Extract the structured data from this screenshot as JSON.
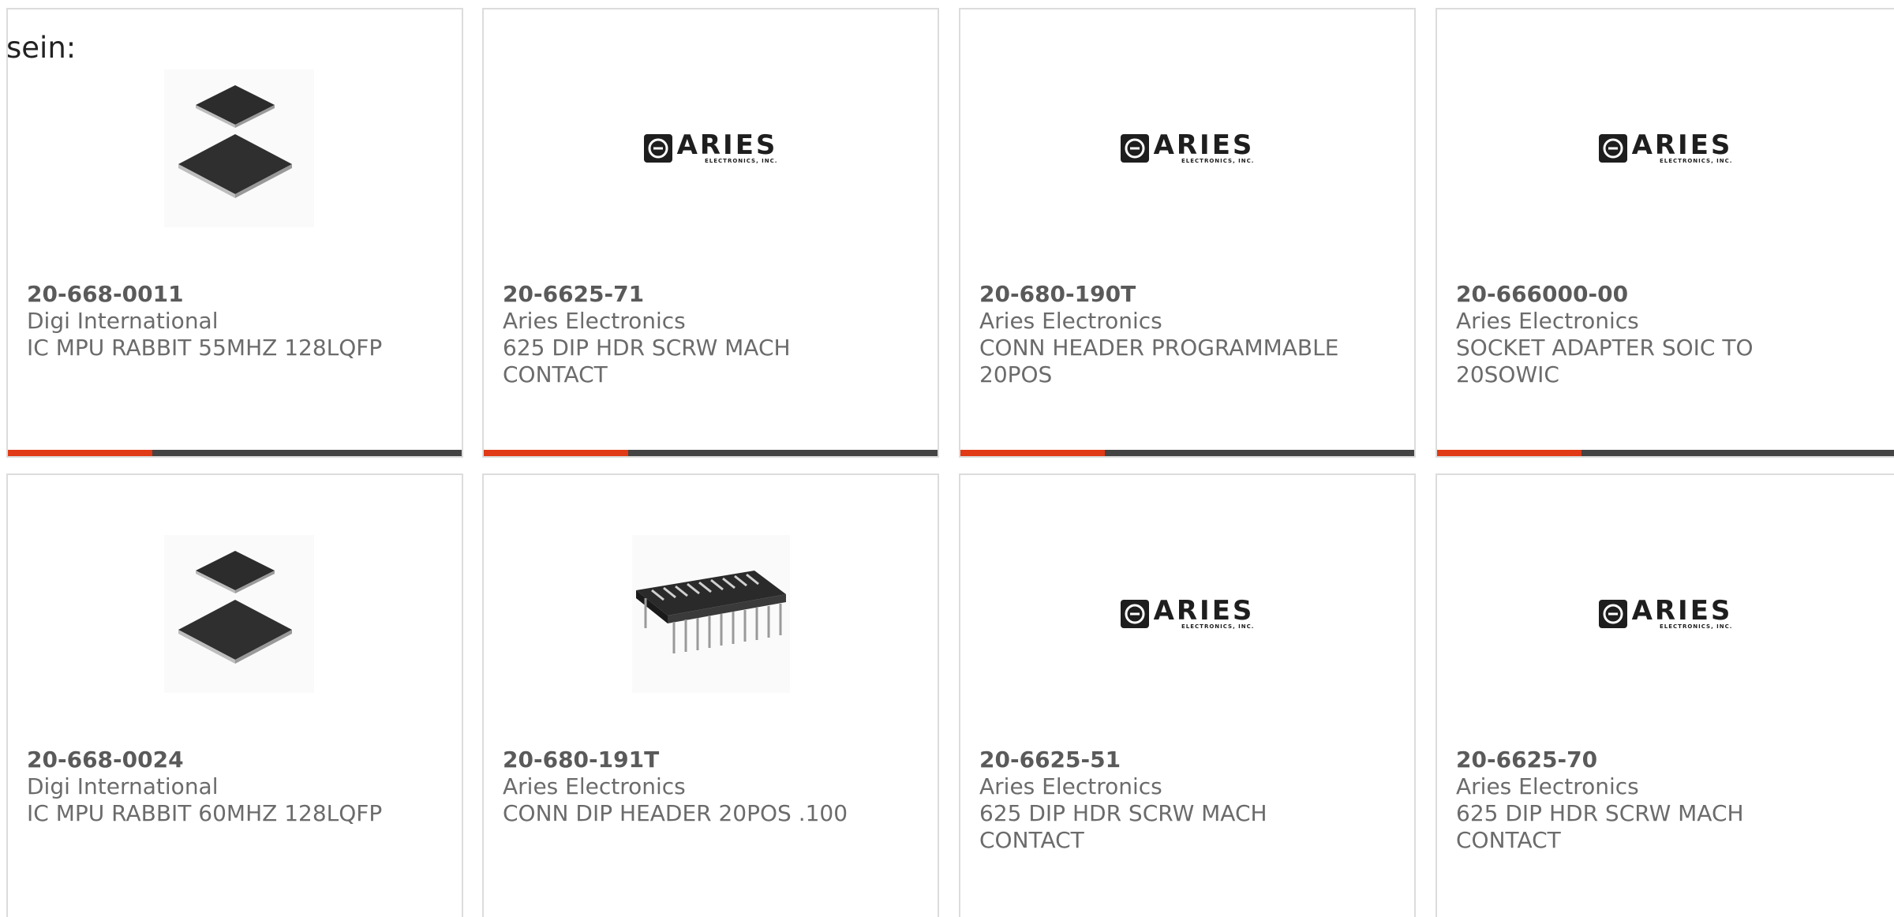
{
  "lead_text": "sein:",
  "cards": [
    {
      "pn": "20-668-0011",
      "mfr": "Digi International",
      "desc": "IC MPU RABBIT 55MHZ 128LQFP",
      "image": "chip-image"
    },
    {
      "pn": "20-6625-71",
      "mfr": "Aries Electronics",
      "desc": "625 DIP HDR SCRW MACH CONTACT",
      "image": "aries-logo"
    },
    {
      "pn": "20-680-190T",
      "mfr": "Aries Electronics",
      "desc": "CONN HEADER PROGRAMMABLE 20POS",
      "image": "aries-logo"
    },
    {
      "pn": "20-666000-00",
      "mfr": "Aries Electronics",
      "desc": "SOCKET ADAPTER SOIC TO 20SOWIC",
      "image": "aries-logo"
    },
    {
      "pn": "20-668-0024",
      "mfr": "Digi International",
      "desc": "IC MPU RABBIT 60MHZ 128LQFP",
      "image": "chip-image"
    },
    {
      "pn": "20-680-191T",
      "mfr": "Aries Electronics",
      "desc": "CONN DIP HEADER 20POS .100",
      "image": "dip-header-image"
    },
    {
      "pn": "20-6625-51",
      "mfr": "Aries Electronics",
      "desc": "625 DIP HDR SCRW MACH CONTACT",
      "image": "aries-logo"
    },
    {
      "pn": "20-6625-70",
      "mfr": "Aries Electronics",
      "desc": "625 DIP HDR SCRW MACH CONTACT",
      "image": "aries-logo"
    }
  ],
  "aries_logo": {
    "name": "ARIES",
    "sub": "ELECTRONICS, INC."
  },
  "colors": {
    "accent": "#e03a16",
    "bar": "#444444",
    "border": "#dcdcdc",
    "text": "#6b6b6b"
  }
}
